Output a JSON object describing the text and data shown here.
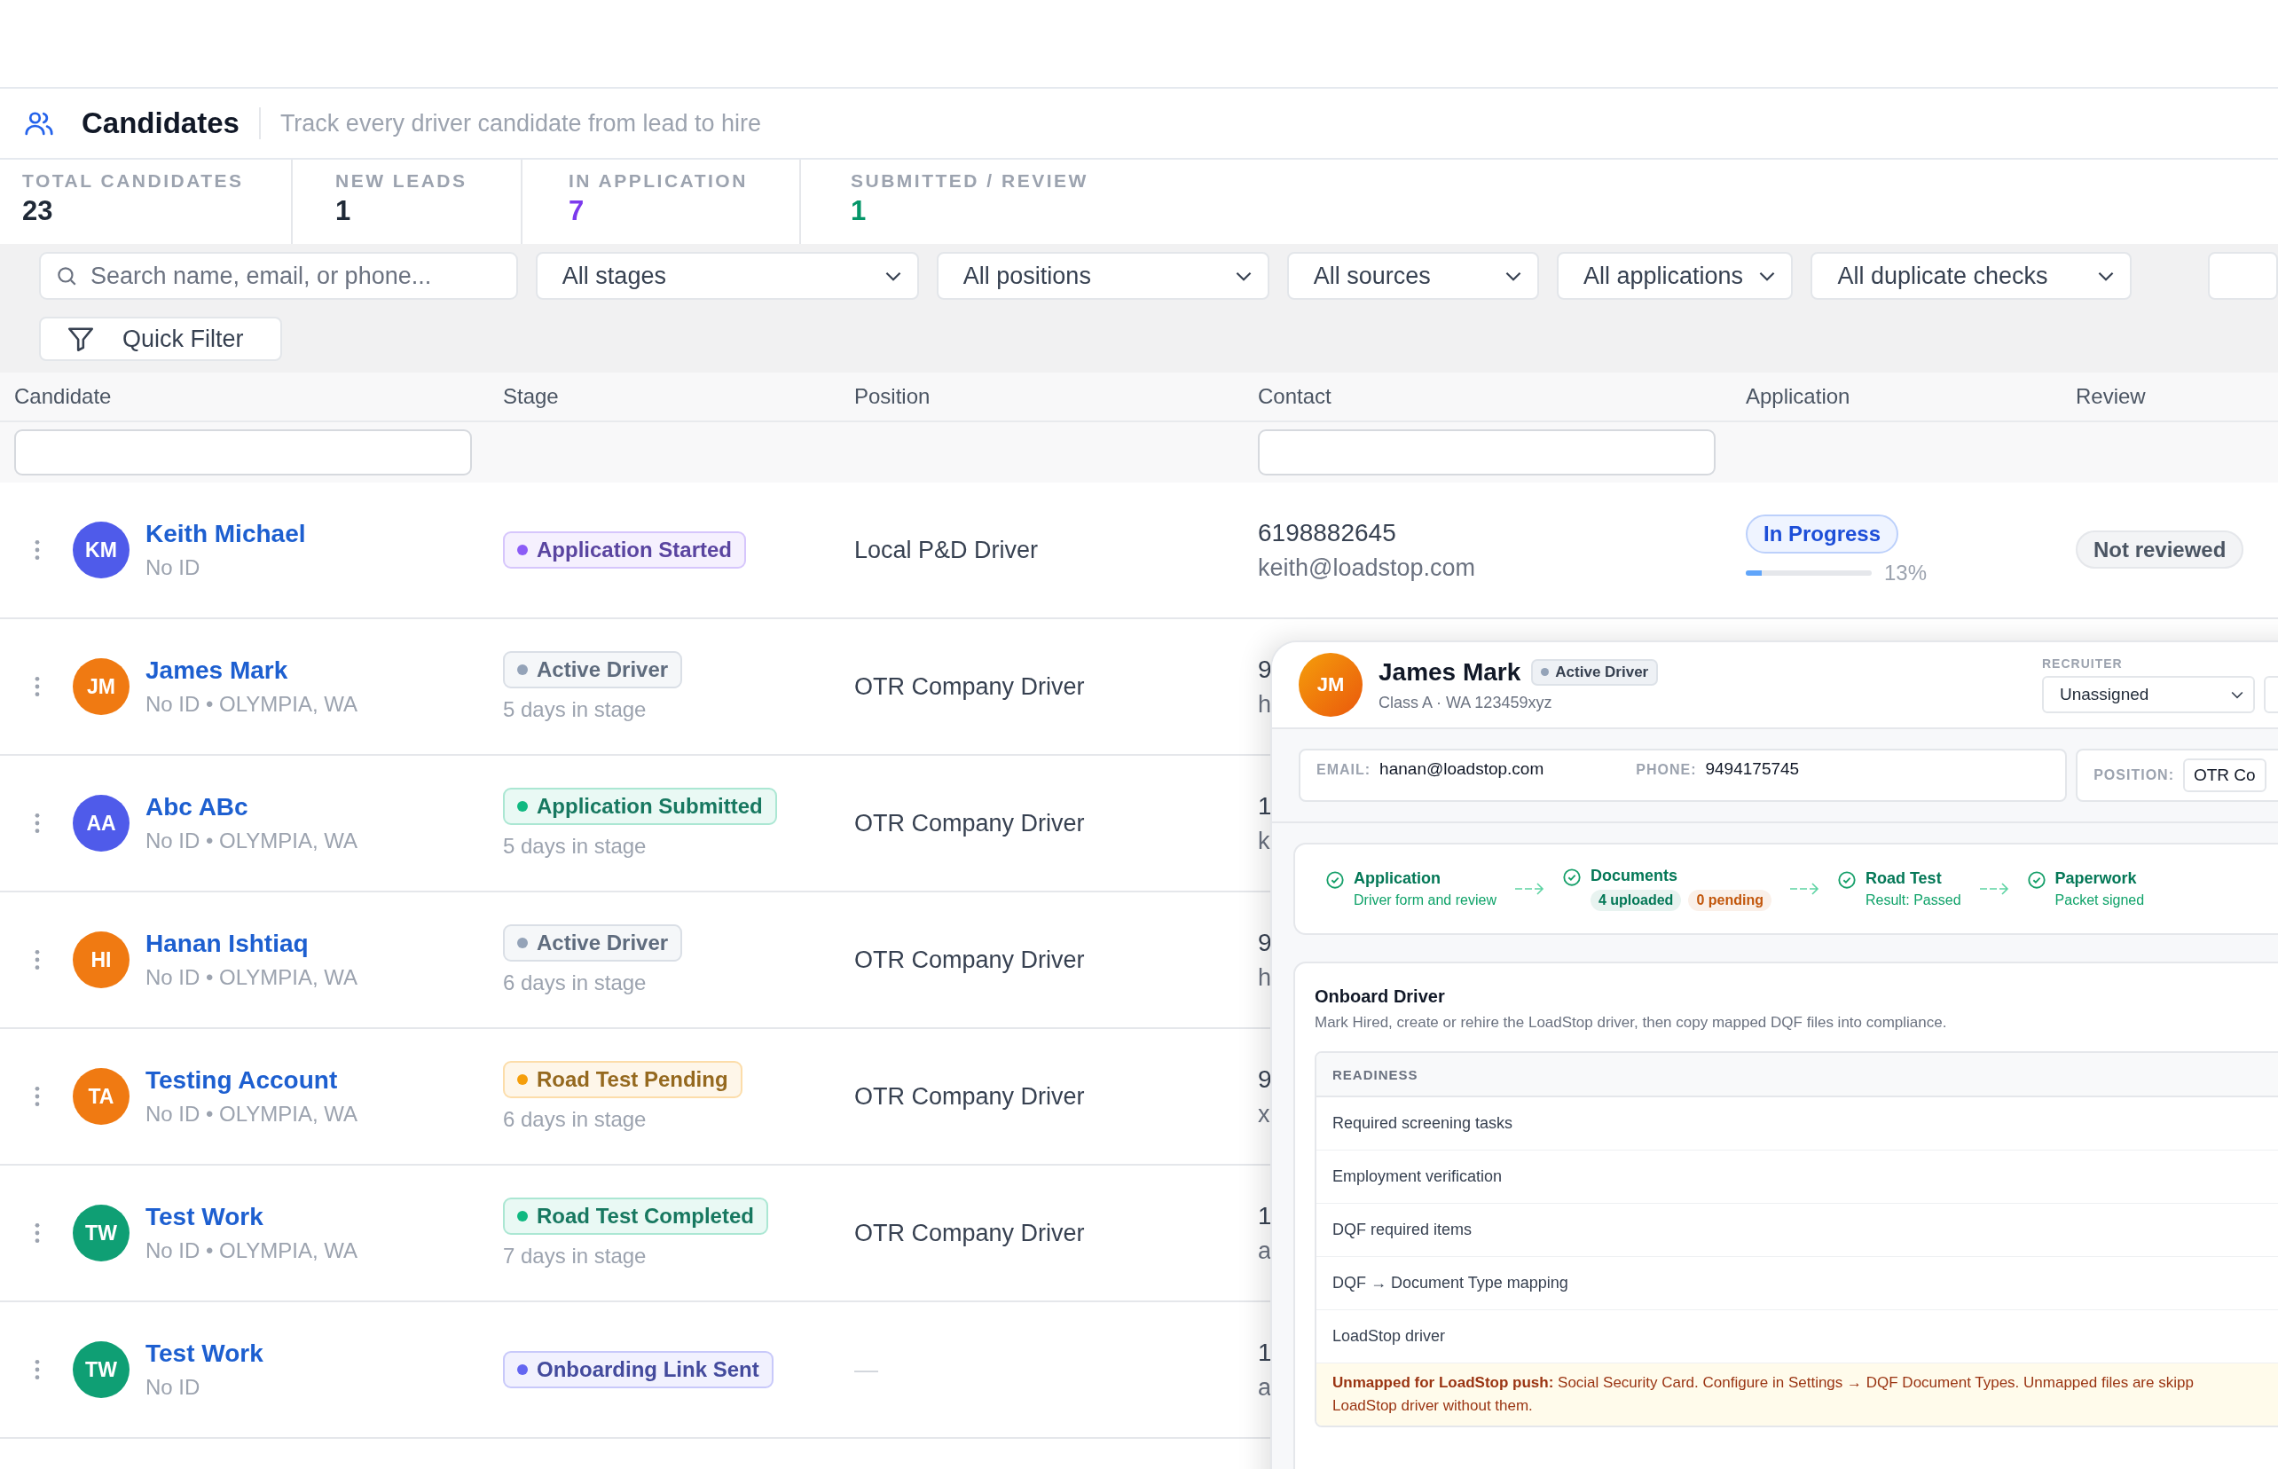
{
  "header": {
    "title": "Candidates",
    "subtitle": "Track every driver candidate from lead to hire"
  },
  "stats": [
    {
      "label": "TOTAL CANDIDATES",
      "value": "23",
      "color": "#1f2937"
    },
    {
      "label": "NEW LEADS",
      "value": "1",
      "color": "#1f2937"
    },
    {
      "label": "IN APPLICATION",
      "value": "7",
      "color": "#7c3aed"
    },
    {
      "label": "SUBMITTED / REVIEW",
      "value": "1",
      "color": "#059669"
    }
  ],
  "filters": {
    "search": {
      "placeholder": "Search name, email, or phone..."
    },
    "dropdowns": [
      "All stages",
      "All positions",
      "All sources",
      "All applications",
      "All duplicate checks"
    ],
    "quick_filter": "Quick Filter"
  },
  "table": {
    "columns": [
      "Candidate",
      "Stage",
      "Position",
      "Contact",
      "Application",
      "Review"
    ],
    "rows": [
      {
        "initials": "KM",
        "color": "#4f5bea",
        "name": "Keith Michael",
        "meta": "No ID",
        "stage": {
          "label": "Application Started",
          "color": "#8b5cf6"
        },
        "position": "Local P&D Driver",
        "phone": "6198882645",
        "email": "keith@loadstop.com",
        "application": {
          "label": "In Progress",
          "level": 0.13,
          "percent": "13%"
        },
        "review": "Not reviewed"
      },
      {
        "initials": "JM",
        "color": "#f07a12",
        "name": "James Mark",
        "meta": "No ID • OLYMPIA, WA",
        "stage": {
          "label": "Active Driver",
          "color": "#94a3b8"
        },
        "days": "5 days in stage",
        "position": "OTR Company Driver",
        "phone": "9",
        "email": "h"
      },
      {
        "initials": "AA",
        "color": "#4f5bea",
        "name": "Abc ABc",
        "meta": "No ID • OLYMPIA, WA",
        "stage": {
          "label": "Application Submitted",
          "color": "#10b981"
        },
        "days": "5 days in stage",
        "position": "OTR Company Driver",
        "phone": "1",
        "email": "k"
      },
      {
        "initials": "HI",
        "color": "#f07a12",
        "name": "Hanan Ishtiaq",
        "meta": "No ID • OLYMPIA, WA",
        "stage": {
          "label": "Active Driver",
          "color": "#94a3b8"
        },
        "days": "6 days in stage",
        "position": "OTR Company Driver",
        "phone": "9",
        "email": "h"
      },
      {
        "initials": "TA",
        "color": "#f07a12",
        "name": "Testing Account",
        "meta": "No ID • OLYMPIA, WA",
        "stage": {
          "label": "Road Test Pending",
          "color": "#f59e0b"
        },
        "days": "6 days in stage",
        "position": "OTR Company Driver",
        "phone": "9",
        "email": "x"
      },
      {
        "initials": "TW",
        "color": "#0f9f74",
        "name": "Test Work",
        "meta": "No ID • OLYMPIA, WA",
        "stage": {
          "label": "Road Test Completed",
          "color": "#10b981"
        },
        "days": "7 days in stage",
        "position": "OTR Company Driver",
        "phone": "1",
        "email": "a"
      },
      {
        "initials": "TW",
        "color": "#0f9f74",
        "name": "Test Work",
        "meta": "No ID",
        "stage": {
          "label": "Onboarding Link Sent",
          "color": "#6366f1"
        },
        "position": "—",
        "phone": "1",
        "email": "a"
      }
    ]
  },
  "panel": {
    "initials": "JM",
    "name": "James Mark",
    "stage": {
      "label": "Active Driver",
      "color": "#94a3b8"
    },
    "license": "Class A · WA 123459xyz",
    "recruiter": {
      "label": "RECRUITER",
      "value": "Unassigned"
    },
    "contact": [
      {
        "label": "EMAIL:",
        "value": "hanan@loadstop.com"
      },
      {
        "label": "PHONE:",
        "value": "9494175745"
      }
    ],
    "position": {
      "label": "POSITION:",
      "value": "OTR Co"
    },
    "steps": [
      {
        "kind": "text",
        "title": "Application",
        "detail": "Driver form and review"
      },
      {
        "kind": "chips",
        "title": "Documents",
        "chips": [
          {
            "label": "4 uploaded",
            "color": "#047857"
          },
          {
            "label": "0 pending",
            "color": "#c2570c"
          }
        ]
      },
      {
        "kind": "text",
        "title": "Road Test",
        "detail": "Result: Passed"
      },
      {
        "kind": "text",
        "title": "Paperwork",
        "detail": "Packet signed"
      }
    ],
    "onboard": {
      "title": "Onboard Driver",
      "description": "Mark Hired, create or rehire the LoadStop driver, then copy mapped DQF files into compliance.",
      "readiness_header": "READINESS",
      "items": [
        "Required screening tasks",
        "Employment verification",
        "DQF required items",
        "DQF → Document Type mapping",
        "LoadStop driver"
      ],
      "warning": [
        "**Unmapped for LoadStop push:** Social Security Card. Configure in Settings → DQF Document Types. Unmapped files are skipp",
        "LoadStop driver without them."
      ]
    }
  }
}
